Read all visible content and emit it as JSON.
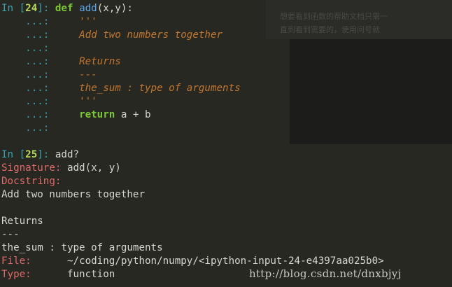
{
  "background_overlay": {
    "ghost_text_line1": "想要看到函数的帮助文档只需一",
    "ghost_text_line2": "直到看到需要的，使用问号就"
  },
  "cell24": {
    "prompt_in": "In [",
    "prompt_num": "24",
    "prompt_close": "]: ",
    "def_kw": "def",
    "fn_name": "add",
    "signature_rest": "(x,y):",
    "continuation": "...:",
    "lines": {
      "doc_open": "'''",
      "doc_summary": "Add two numbers together",
      "doc_returns": "Returns",
      "doc_dashes": "---",
      "doc_the_sum": "the_sum : type of arguments",
      "doc_close": "'''",
      "return_kw": "return",
      "return_expr": " a + b"
    }
  },
  "cell25": {
    "prompt_in": "In [",
    "prompt_num": "25",
    "prompt_close": "]: ",
    "command": "add?"
  },
  "output": {
    "signature_label": "Signature:",
    "signature_value": " add(x, y)",
    "docstring_label": "Docstring:",
    "doc_summary": "Add two numbers together",
    "doc_returns": "Returns",
    "doc_dashes": "---",
    "doc_the_sum": "the_sum : type of arguments",
    "file_label": "File:",
    "file_value": "      ~/coding/python/numpy/<ipython-input-24-e4397aa025b0>",
    "type_label": "Type:",
    "type_value": "      function"
  },
  "watermark": "http://blog.csdn.net/dnxbjyj",
  "colors": {
    "background": "#272822",
    "prompt": "#3aa3ad",
    "prompt_number": "#b6d95a",
    "keyword": "#7cc832",
    "function_name": "#5ea6ea",
    "docstring": "#c1762f",
    "label_red": "#e06a6a",
    "text": "#d6d6cc"
  }
}
